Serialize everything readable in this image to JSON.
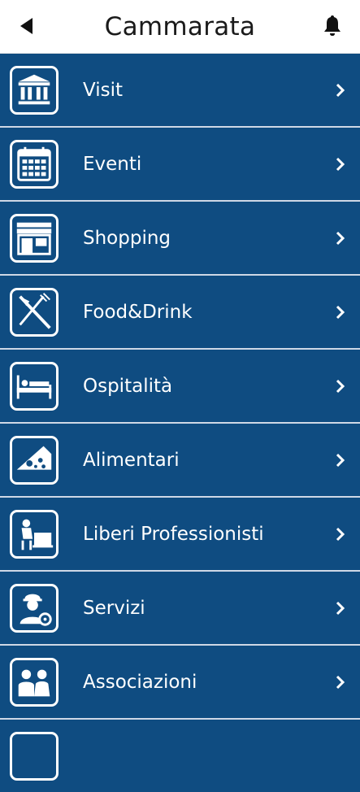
{
  "header": {
    "title": "Cammarata",
    "back_icon": "back-arrow-icon",
    "bell_icon": "bell-icon"
  },
  "colors": {
    "row_bg": "#0f4c81",
    "header_bg": "#ffffff",
    "text_on_row": "#ffffff"
  },
  "menu": [
    {
      "label": "Visit",
      "icon": "museum-icon"
    },
    {
      "label": "Eventi",
      "icon": "calendar-icon"
    },
    {
      "label": "Shopping",
      "icon": "shop-icon"
    },
    {
      "label": "Food&Drink",
      "icon": "fork-knife-icon"
    },
    {
      "label": "Ospitalità",
      "icon": "bed-icon"
    },
    {
      "label": "Alimentari",
      "icon": "cheese-icon"
    },
    {
      "label": "Liberi Professionisti",
      "icon": "professional-icon"
    },
    {
      "label": "Servizi",
      "icon": "worker-gear-icon"
    },
    {
      "label": "Associazioni",
      "icon": "people-icon"
    },
    {
      "label": "",
      "icon": "partial-row-icon"
    }
  ]
}
